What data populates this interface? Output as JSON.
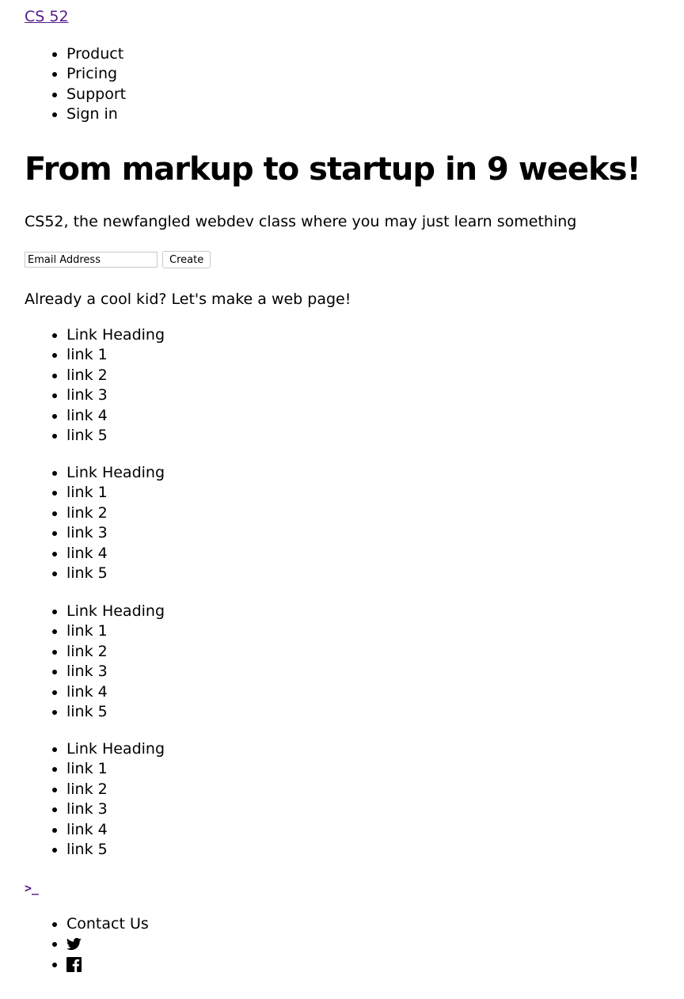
{
  "header": {
    "brand": "CS 52",
    "nav": [
      "Product",
      "Pricing",
      "Support",
      "Sign in"
    ]
  },
  "hero": {
    "title": "From markup to startup in 9 weeks!",
    "subtitle": "CS52, the newfangled webdev class where you may just learn something",
    "email_placeholder": "Email Address",
    "create_label": "Create",
    "cta": "Already a cool kid? Let's make a web page!"
  },
  "link_groups": [
    {
      "heading": "Link Heading",
      "links": [
        "link 1",
        "link 2",
        "link 3",
        "link 4",
        "link 5"
      ]
    },
    {
      "heading": "Link Heading",
      "links": [
        "link 1",
        "link 2",
        "link 3",
        "link 4",
        "link 5"
      ]
    },
    {
      "heading": "Link Heading",
      "links": [
        "link 1",
        "link 2",
        "link 3",
        "link 4",
        "link 5"
      ]
    },
    {
      "heading": "Link Heading",
      "links": [
        "link 1",
        "link 2",
        "link 3",
        "link 4",
        "link 5"
      ]
    }
  ],
  "footer": {
    "logo": ">_",
    "contact": "Contact Us",
    "social": [
      {
        "icon": "twitter-icon"
      },
      {
        "icon": "facebook-icon"
      }
    ]
  },
  "colors": {
    "link_visited": "#551a8b",
    "text": "#000000",
    "background": "#ffffff"
  }
}
